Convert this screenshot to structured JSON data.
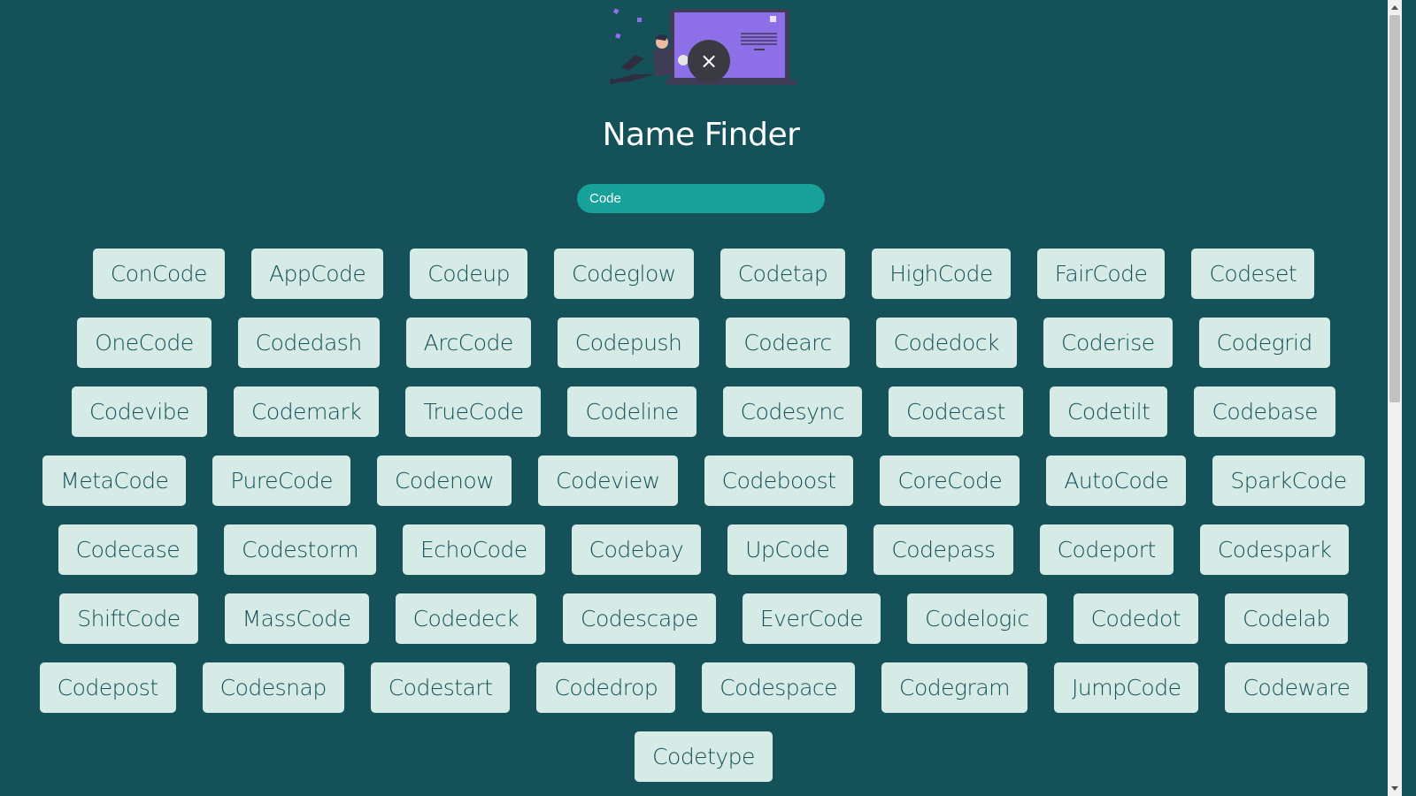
{
  "app": {
    "title": "Name Finder",
    "close_symbol": "×"
  },
  "search": {
    "value": "Code",
    "placeholder": ""
  },
  "names": [
    "ConCode",
    "AppCode",
    "Codeup",
    "Codeglow",
    "Codetap",
    "HighCode",
    "FairCode",
    "Codeset",
    "OneCode",
    "Codedash",
    "ArcCode",
    "Codepush",
    "Codearc",
    "Codedock",
    "Coderise",
    "Codegrid",
    "Codevibe",
    "Codemark",
    "TrueCode",
    "Codeline",
    "Codesync",
    "Codecast",
    "Codetilt",
    "Codebase",
    "MetaCode",
    "PureCode",
    "Codenow",
    "Codeview",
    "Codeboost",
    "CoreCode",
    "AutoCode",
    "SparkCode",
    "Codecase",
    "Codestorm",
    "EchoCode",
    "Codebay",
    "UpCode",
    "Codepass",
    "Codeport",
    "Codespark",
    "ShiftCode",
    "MassCode",
    "Codedeck",
    "Codescape",
    "EverCode",
    "Codelogic",
    "Codedot",
    "Codelab",
    "Codepost",
    "Codesnap",
    "Codestart",
    "Codedrop",
    "Codespace",
    "Codegram",
    "JumpCode",
    "Codeware",
    "Codetype"
  ],
  "colors": {
    "background": "#145158",
    "card": "#d6ebe6",
    "card_text": "#145158",
    "search_field": "#17a19a",
    "illustration_accent": "#8d6fe8"
  },
  "icons": {
    "close": "close-icon",
    "hero": "hero-illustration"
  }
}
